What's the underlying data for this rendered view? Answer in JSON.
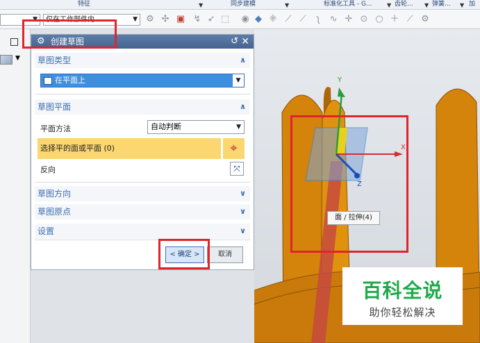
{
  "ribbon": {
    "groups": [
      "特征",
      "同步建模",
      "标准化工具 - G...",
      "齿轮...",
      "弹簧...",
      "加"
    ]
  },
  "toolbar": {
    "filter_value": "",
    "scope_value": "仅在工作部件内"
  },
  "dialog": {
    "title": "创建草图",
    "section_type": {
      "label": "草图类型",
      "value": "在平面上"
    },
    "section_plane": {
      "label": "草图平面",
      "method_label": "平面方法",
      "method_value": "自动判断",
      "select_label": "选择平的面或平面 (0)",
      "reverse_label": "反向"
    },
    "section_orientation": "草图方向",
    "section_origin": "草图原点",
    "section_settings": "设置",
    "ok_label": "< 确定 >",
    "cancel_label": "取消"
  },
  "viewport": {
    "tooltip": "面 / 拉伸(4)",
    "axis_x": "X",
    "axis_y": "Y",
    "axis_z": "Z",
    "triad_z": "Z"
  },
  "watermark": {
    "title": "百科全说",
    "subtitle": "助你轻松解决"
  },
  "colors": {
    "accent": "#3c6fb0",
    "selection": "#fcd66f",
    "highlight_box": "#e0242b",
    "model": "#d4830b"
  }
}
